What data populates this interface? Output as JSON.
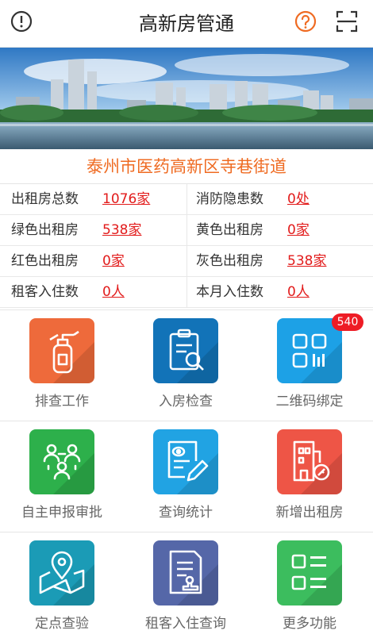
{
  "header": {
    "title": "高新房管通",
    "accent_color": "#ef6b22"
  },
  "location": "泰州市医药高新区寺巷街道",
  "stats": [
    {
      "label": "出租房总数",
      "value": "1076家"
    },
    {
      "label": "消防隐患数",
      "value": "0处"
    },
    {
      "label": "绿色出租房",
      "value": "538家"
    },
    {
      "label": "黄色出租房",
      "value": "0家"
    },
    {
      "label": "红色出租房",
      "value": "0家"
    },
    {
      "label": "灰色出租房",
      "value": "538家"
    },
    {
      "label": "租客入住数",
      "value": "0人"
    },
    {
      "label": "本月入住数",
      "value": "0人"
    }
  ],
  "menu": [
    {
      "label": "排查工作",
      "icon": "fire-extinguisher-icon",
      "color": "#ee6a3b"
    },
    {
      "label": "入房检查",
      "icon": "clipboard-search-icon",
      "color": "#1273b8"
    },
    {
      "label": "二维码绑定",
      "icon": "qr-code-icon",
      "color": "#1da1e6",
      "badge": "540"
    },
    {
      "label": "自主申报审批",
      "icon": "people-group-icon",
      "color": "#2db04b"
    },
    {
      "label": "查询统计",
      "icon": "edit-document-icon",
      "color": "#21a3e3"
    },
    {
      "label": "新增出租房",
      "icon": "house-key-icon",
      "color": "#ee5546"
    },
    {
      "label": "定点查验",
      "icon": "map-location-icon",
      "color": "#1b9bb6"
    },
    {
      "label": "租客入住查询",
      "icon": "document-stamp-icon",
      "color": "#5567a8"
    },
    {
      "label": "更多功能",
      "icon": "more-grid-icon",
      "color": "#3cbd5e"
    }
  ]
}
